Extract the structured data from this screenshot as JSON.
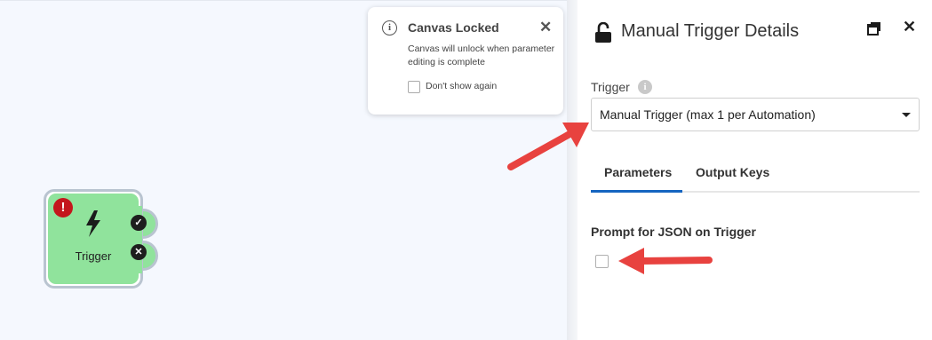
{
  "canvas": {
    "node": {
      "label": "Trigger",
      "icon": "lightning-bolt-icon",
      "error_badge": "!",
      "ports": [
        "success-port-icon",
        "failure-port-icon"
      ]
    }
  },
  "toast": {
    "title": "Canvas Locked",
    "body": "Canvas will unlock when parameter editing is complete",
    "checkbox_label": "Don't show again",
    "close": "✕"
  },
  "panel": {
    "title": "Manual Trigger Details",
    "close": "✕",
    "trigger_label": "Trigger",
    "help": "i",
    "trigger_select_value": "Manual Trigger (max 1 per Automation)",
    "tabs": [
      {
        "label": "Parameters",
        "active": true
      },
      {
        "label": "Output Keys",
        "active": false
      }
    ],
    "section_title": "Prompt for JSON on Trigger"
  },
  "colors": {
    "node_fill": "#90e39c",
    "error": "#c4161c",
    "accent": "#1565c0",
    "arrow": "#e8423f"
  }
}
